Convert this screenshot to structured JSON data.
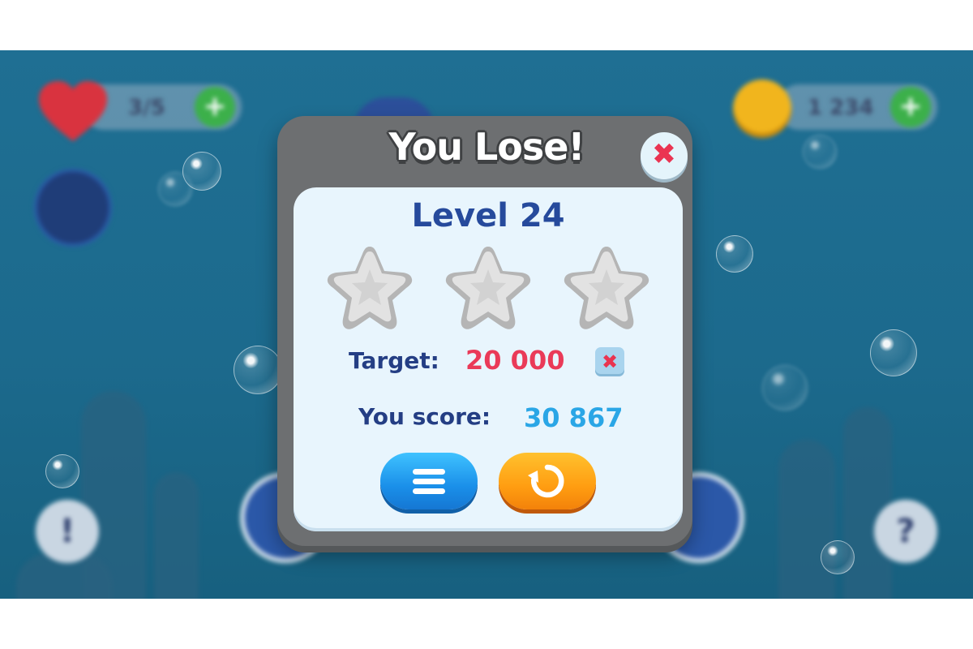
{
  "hud": {
    "lives": "3/5",
    "coins": "1 234",
    "plus_glyph": "+",
    "info_glyph": "!",
    "help_glyph": "?"
  },
  "popup": {
    "title": "You Lose!",
    "close_glyph": "✖",
    "level_label": "Level 24",
    "stars_earned": 0,
    "stars_total": 3,
    "target_label": "Target:",
    "target_value": "20 000",
    "target_status_glyph": "✖",
    "score_label": "You score:",
    "score_value": "30 867"
  },
  "buttons": {
    "menu_icon": "menu-icon",
    "replay_icon": "replay-icon"
  },
  "colors": {
    "background": "#1f6f93",
    "popup_frame": "#6d6f71",
    "panel": "#e8f5fd",
    "level_text": "#264a9c",
    "target_value": "#ea3a58",
    "score_value": "#2aa6e6",
    "menu_button": "#1a8fe9",
    "replay_button": "#ff9d11"
  }
}
